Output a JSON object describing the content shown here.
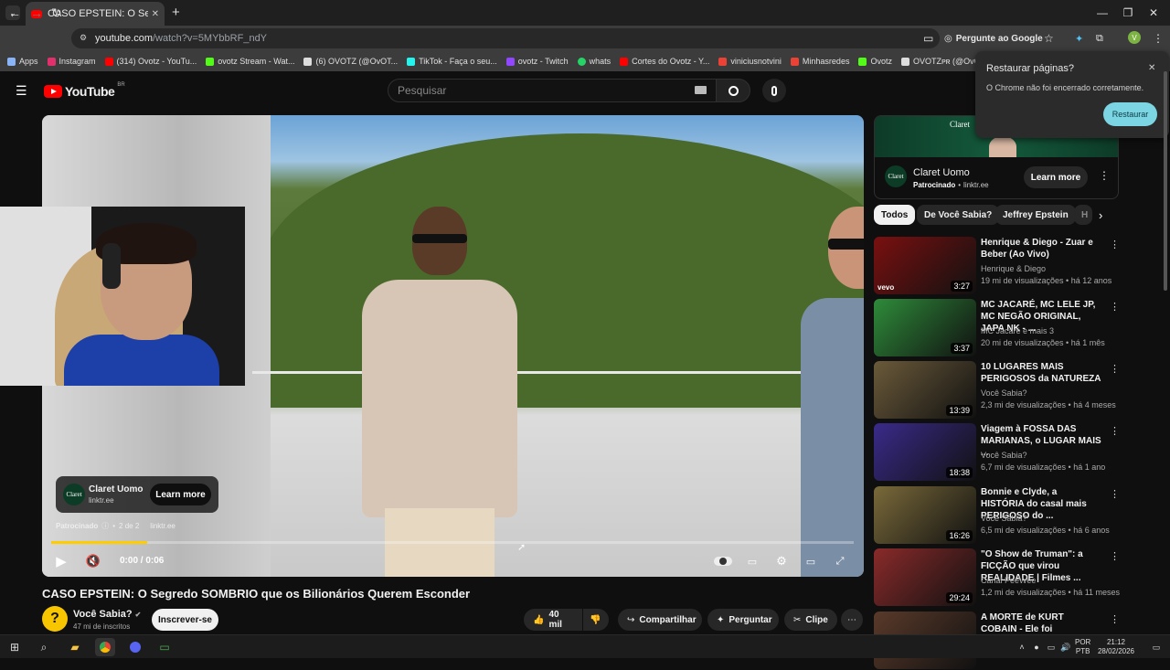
{
  "browser": {
    "tab_title": "CASO EPSTEIN: O Segredo SOM",
    "new_tab": "+",
    "url_host": "youtube.com",
    "url_path": "/watch?v=5MYbbRF_ndY",
    "ask_google": "Pergunte ao Google",
    "profile_initial": "V",
    "bookmarks": [
      {
        "label": "Apps",
        "color": "#8ab4f8"
      },
      {
        "label": "Instagram",
        "color": "#e1306c"
      },
      {
        "label": "(314) Ovotz - YouTu...",
        "color": "#ff0000"
      },
      {
        "label": "ovotz Stream - Wat...",
        "color": "#53fc18"
      },
      {
        "label": "(6) OVOTZ (@OvOT...",
        "color": "#ffffff"
      },
      {
        "label": "TikTok - Faça o seu...",
        "color": "#25f4ee"
      },
      {
        "label": "ovotz - Twitch",
        "color": "#9146ff"
      },
      {
        "label": "whats",
        "color": "#25d366"
      },
      {
        "label": "Cortes do Ovotz - Y...",
        "color": "#ff0000"
      },
      {
        "label": "viniciusnotvini",
        "color": "#ea4335"
      },
      {
        "label": "Minhasredes",
        "color": "#ea4335"
      },
      {
        "label": "Ovotz",
        "color": "#53fc18"
      },
      {
        "label": "OVOTZᴘʀ (@OvOTzF...",
        "color": "#ffffff"
      }
    ]
  },
  "popup": {
    "title": "Restaurar páginas?",
    "message": "O Chrome não foi encerrado corretamente.",
    "button": "Restaurar",
    "close": "✕"
  },
  "youtube": {
    "logo_text": "YouTube",
    "region": "BR",
    "search_placeholder": "Pesquisar"
  },
  "player": {
    "sponsor_name": "Claret Uomo",
    "sponsor_url": "linktr.ee",
    "sponsor_logo": "Claret",
    "learn_more": "Learn more",
    "ad_label": "Patrocinado",
    "ad_count": "2 de 2",
    "ad_domain": "linktr.ee",
    "time": "0:00 / 0:06",
    "progress": 0.12
  },
  "video": {
    "title": "CASO EPSTEIN: O Segredo SOMBRIO que os Bilionários Querem Esconder",
    "channel": "Você Sabia?",
    "subscribers": "47 mi de inscritos",
    "subscribe": "Inscrever-se",
    "likes": "40 mil",
    "share": "Compartilhar",
    "ask": "Perguntar",
    "clip": "Clipe"
  },
  "ad_card": {
    "name": "Claret Uomo",
    "sponsored": "Patrocinado",
    "domain": "linktr.ee",
    "learn_more": "Learn more",
    "logo": "Claret"
  },
  "chips": [
    "Todos",
    "De Você Sabia?",
    "Jeffrey Epstein",
    "H"
  ],
  "recommendations": [
    {
      "title": "Henrique & Diego - Zuar e Beber (Ao Vivo)",
      "channel": "Henrique & Diego",
      "meta": "19 mi de visualizações • há 12 anos",
      "duration": "3:27",
      "color": "#7a1010",
      "badge": "vevo"
    },
    {
      "title": "MC JACARÉ, MC LELE JP, MC NEGÃO ORIGINAL, JAPA NK - ...",
      "channel": "MC Jacaré  e mais 3",
      "meta": "20 mi de visualizações • há 1 mês",
      "duration": "3:37",
      "color": "#2e8b3a",
      "badge": ""
    },
    {
      "title": "10 LUGARES MAIS PERIGOSOS da NATUREZA",
      "channel": "Você Sabia?",
      "meta": "2,3 mi de visualizações • há 4 meses",
      "duration": "13:39",
      "color": "#6b5a3a",
      "badge": ""
    },
    {
      "title": "Viagem à FOSSA DAS MARIANAS, o LUGAR MAIS ...",
      "channel": "Você Sabia?",
      "meta": "6,7 mi de visualizações • há 1 ano",
      "duration": "18:38",
      "color": "#3a2a8a",
      "badge": ""
    },
    {
      "title": "Bonnie e Clyde, a HISTÓRIA do casal mais PERIGOSO do ...",
      "channel": "Você Sabia?",
      "meta": "6,5 mi de visualizações • há 6 anos",
      "duration": "16:26",
      "color": "#7a6a3a",
      "badge": ""
    },
    {
      "title": "\"O Show de Truman\": a FICÇÃO que virou REALIDADE | Filmes ...",
      "channel": "Canal PeeWee",
      "meta": "1,2 mi de visualizações • há 11 meses",
      "duration": "29:24",
      "color": "#8a2a2a",
      "badge": ""
    },
    {
      "title": "A MORTE de KURT COBAIN - Ele foi ASSASSINADO?",
      "channel": "",
      "meta": "",
      "duration": "",
      "color": "#5a3a2a",
      "badge": ""
    }
  ],
  "taskbar": {
    "lang1": "POR",
    "lang2": "PTB",
    "time": "21:12",
    "date": "28/02/2026"
  }
}
